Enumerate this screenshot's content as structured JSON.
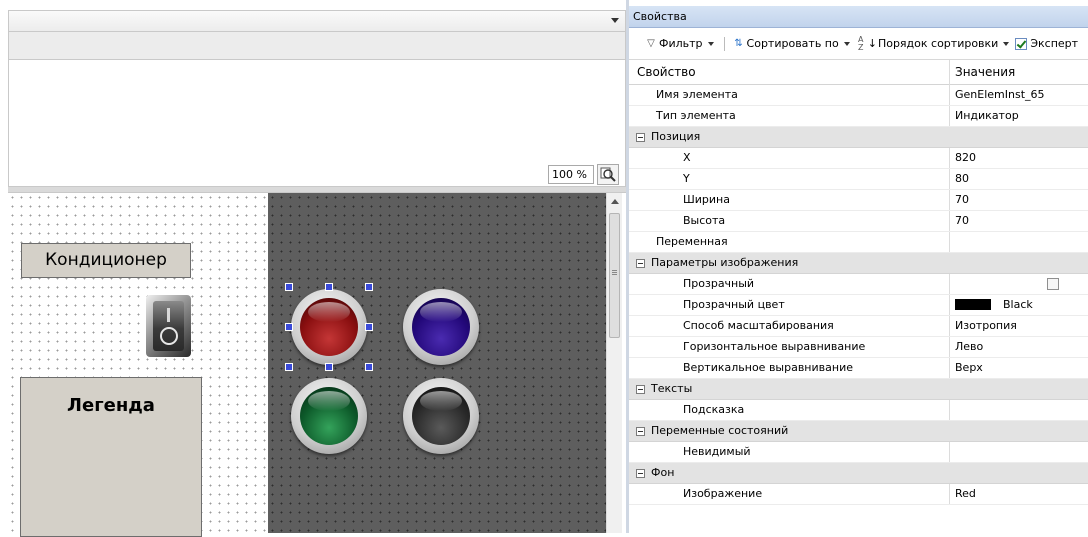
{
  "editor": {
    "zoom_level": "100 %",
    "conditioner_label": "Кондиционер",
    "legend_label": "Легенда"
  },
  "properties": {
    "title": "Свойства",
    "toolbar": {
      "filter_label": "Фильтр",
      "sort_by_label": "Сортировать по",
      "sort_order_label": "Порядок сортировки",
      "expert_label": "Эксперт",
      "expert_checked": true
    },
    "header": {
      "property": "Свойство",
      "value": "Значения"
    },
    "rows": {
      "element_name": {
        "label": "Имя элемента",
        "value": "GenElemInst_65"
      },
      "element_type": {
        "label": "Тип элемента",
        "value": "Индикатор"
      },
      "position": {
        "label": "Позиция"
      },
      "x": {
        "label": "X",
        "value": "820"
      },
      "y": {
        "label": "Y",
        "value": "80"
      },
      "width": {
        "label": "Ширина",
        "value": "70"
      },
      "height": {
        "label": "Высота",
        "value": "70"
      },
      "variable": {
        "label": "Переменная",
        "value": ""
      },
      "image_params": {
        "label": "Параметры изображения"
      },
      "transparent": {
        "label": "Прозрачный",
        "checked": false
      },
      "transparent_color": {
        "label": "Прозрачный цвет",
        "value": "Black",
        "swatch": "#000000"
      },
      "scale_mode": {
        "label": "Способ масштабирования",
        "value": "Изотропия"
      },
      "h_align": {
        "label": "Горизонтальное выравнивание",
        "value": "Лево"
      },
      "v_align": {
        "label": "Вертикальное выравнивание",
        "value": "Верх"
      },
      "texts": {
        "label": "Тексты"
      },
      "tooltip": {
        "label": "Подсказка",
        "value": ""
      },
      "state_vars": {
        "label": "Переменные состояний"
      },
      "invisible": {
        "label": "Невидимый",
        "value": ""
      },
      "background": {
        "label": "Фон"
      },
      "image": {
        "label": "Изображение",
        "value": "Red"
      }
    }
  },
  "colors": {
    "highlight_underline": "#e31c1c",
    "selection_handle": "#3a4ad8",
    "lamps": [
      "red",
      "blue",
      "green",
      "black"
    ]
  }
}
